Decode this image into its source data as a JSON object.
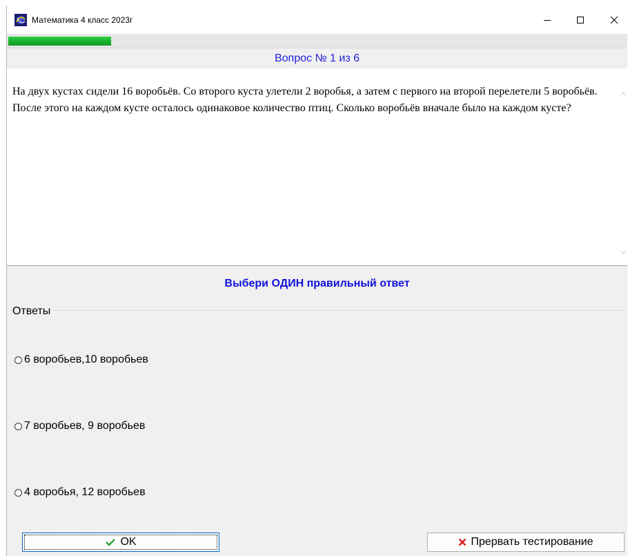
{
  "window": {
    "title": "Математика 4 класс 2023г",
    "icon": "app-logo-icon",
    "controls": [
      "minimize-icon",
      "maximize-icon",
      "close-icon"
    ]
  },
  "progress": {
    "fraction": 0.1667,
    "color": "#1bb32f"
  },
  "question": {
    "header": "Вопрос № 1 из 6",
    "number": 1,
    "total": 6,
    "text": "На двух кустах сидели 16 воробьёв. Со второго куста улетели 2 воробья, а затем с первого на второй перелетели 5 воробьёв. После этого на каждом кусте осталось одинаковое количество птиц. Сколько воробьёв вначале было на каждом кусте?"
  },
  "instruction": "Выбери ОДИН правильный ответ",
  "answers": {
    "legend": "Ответы",
    "options": [
      {
        "label": "6 воробьев,10 воробьев",
        "selected": false
      },
      {
        "label": "7 воробьев, 9 воробьев",
        "selected": false
      },
      {
        "label": "4 воробья, 12 воробьев",
        "selected": false
      }
    ]
  },
  "buttons": {
    "ok_label": "OK",
    "ok_icon": "checkmark-icon",
    "abort_label": "Прервать тестирование",
    "abort_icon": "cross-icon"
  },
  "colors": {
    "header_text": "#2222dd",
    "instruction_text": "#1111dd",
    "ok_icon": "#2aa83a",
    "abort_icon": "#e02020"
  }
}
